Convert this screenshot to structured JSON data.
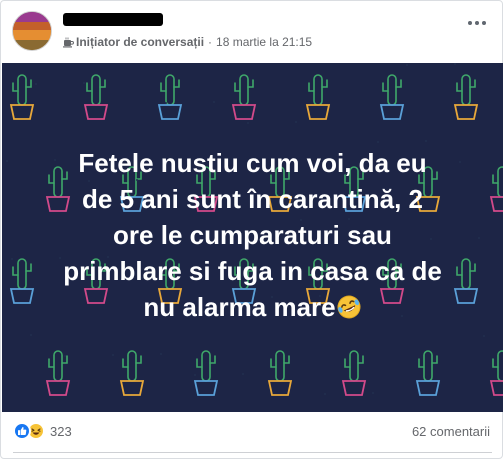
{
  "post": {
    "author_badge": "Inițiator de conversații",
    "separator": "·",
    "timestamp": "18 martie la 21:15",
    "caption_lines": [
      "Fetele nustiu cum voi, da eu",
      "de 5 ani sunt în carantină, 2",
      "ore le cumparaturi sau",
      "primblare si fuga in casa ca de",
      "nu alarma mare"
    ],
    "background_color": "#1d2546"
  },
  "footer": {
    "reaction_count": "323",
    "comment_count": "62 comentarii"
  },
  "icons": {
    "badge": "conversation-starter-icon",
    "more": "more-options-icon",
    "like": "like-icon",
    "haha": "haha-icon",
    "caption_emoji": "rolling-laughing-emoji"
  },
  "colors": {
    "like_blue": "#1877f2",
    "haha_yellow": "#f7c337",
    "meta_gray": "#65676b"
  }
}
